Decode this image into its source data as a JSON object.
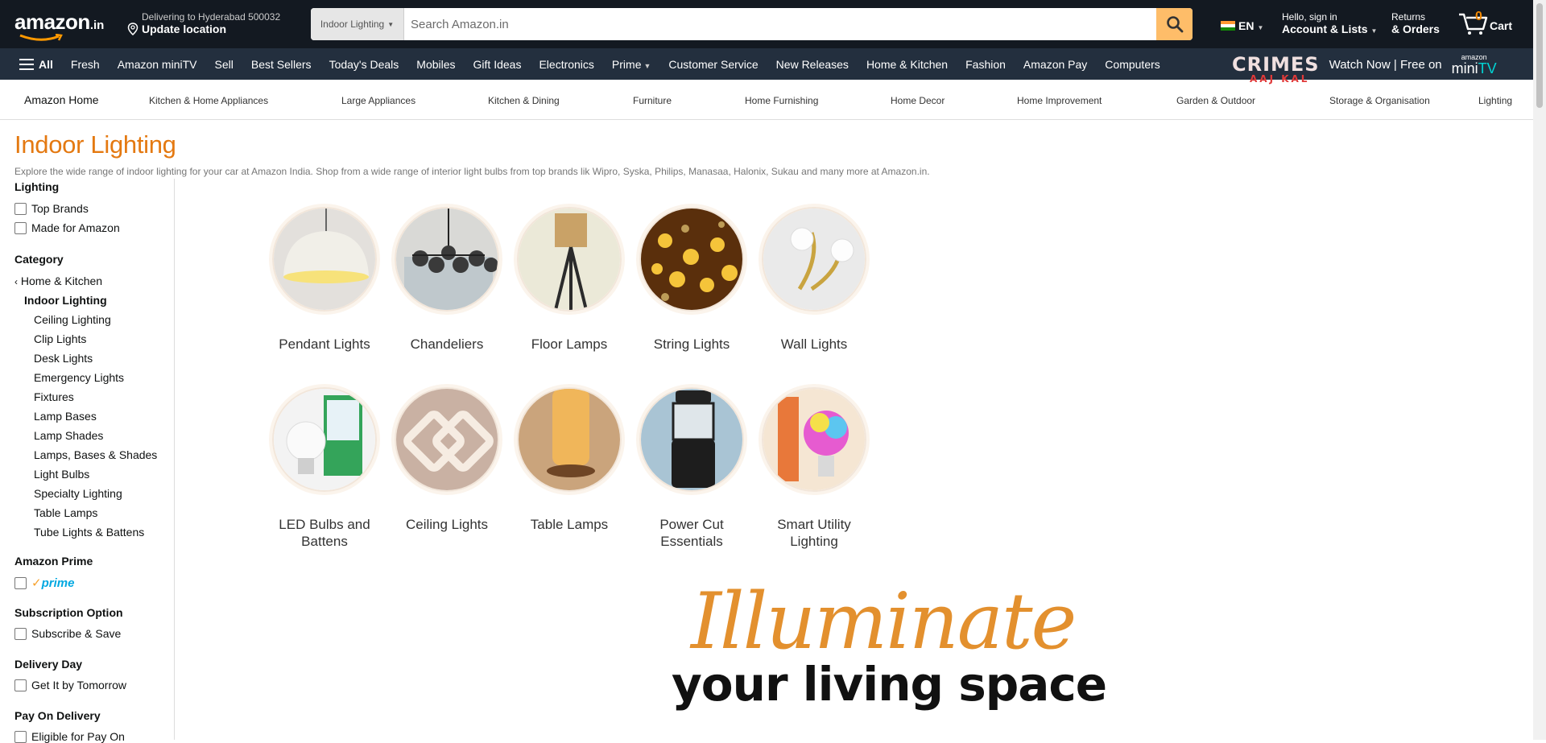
{
  "header": {
    "logo_text": "amazon",
    "logo_suffix": ".in",
    "deliver_line1": "Delivering to Hyderabad 500032",
    "deliver_line2": "Update location",
    "search_category": "Indoor Lighting",
    "search_placeholder": "Search Amazon.in",
    "language": "EN",
    "account_line1": "Hello, sign in",
    "account_line2": "Account & Lists",
    "returns_line1": "Returns",
    "returns_line2": "& Orders",
    "cart_count": "0",
    "cart_label": "Cart"
  },
  "nav": {
    "all_label": "All",
    "items": [
      "Fresh",
      "Amazon miniTV",
      "Sell",
      "Best Sellers",
      "Today's Deals",
      "Mobiles",
      "Gift Ideas",
      "Electronics",
      "Prime",
      "Customer Service",
      "New Releases",
      "Home & Kitchen",
      "Fashion",
      "Amazon Pay",
      "Computers"
    ],
    "promo_crimes": "CRIMES",
    "promo_aaj": "AAJ KAL",
    "promo_text": "Watch Now | Free on",
    "minitv_top": "amazon",
    "minitv_mini": "mini",
    "minitv_tv": "TV"
  },
  "subnav": {
    "home": "Amazon Home",
    "items": [
      "Kitchen & Home Appliances",
      "Large Appliances",
      "Kitchen & Dining",
      "Furniture",
      "Home Furnishing",
      "Home Decor",
      "Home Improvement",
      "Garden & Outdoor",
      "Storage & Organisation",
      "Lighting"
    ]
  },
  "page": {
    "title": "Indoor Lighting",
    "description": "Explore the wide range of indoor lighting for your car at Amazon India. Shop from a wide range of interior light bulbs from top brands lik Wipro, Syska, Philips, Manasaa, Halonix, Sukau and many more at Amazon.in."
  },
  "sidebar": {
    "lighting_head": "Lighting",
    "top_brands": "Top Brands",
    "made_for_amazon": "Made for Amazon",
    "category_head": "Category",
    "home_kitchen": "Home & Kitchen",
    "indoor_lighting": "Indoor Lighting",
    "categories": [
      "Ceiling Lighting",
      "Clip Lights",
      "Desk Lights",
      "Emergency Lights",
      "Fixtures",
      "Lamp Bases",
      "Lamp Shades",
      "Lamps, Bases & Shades",
      "Light Bulbs",
      "Specialty Lighting",
      "Table Lamps",
      "Tube Lights & Battens"
    ],
    "prime_head": "Amazon Prime",
    "prime_label": "prime",
    "subscription_head": "Subscription Option",
    "subscribe_save": "Subscribe & Save",
    "delivery_head": "Delivery Day",
    "get_tomorrow": "Get It by Tomorrow",
    "pod_head": "Pay On Delivery",
    "pod_label": "Eligible for Pay On"
  },
  "tiles": {
    "row1": [
      "Pendant Lights",
      "Chandeliers",
      "Floor Lamps",
      "String Lights",
      "Wall Lights"
    ],
    "row2_line1": [
      "LED Bulbs and",
      "Ceiling Lights",
      "Table Lamps",
      "Power Cut",
      "Smart Utility"
    ],
    "row2_line2": [
      "Battens",
      "",
      "",
      "Essentials",
      "Lighting"
    ]
  },
  "banner": {
    "script": "Illuminate",
    "main": "your living space"
  },
  "colors": {
    "header_bg": "#131921",
    "nav_bg": "#232f3e",
    "title_orange": "#e47911",
    "search_button": "#febd69",
    "banner_gold": "#e3902e"
  }
}
